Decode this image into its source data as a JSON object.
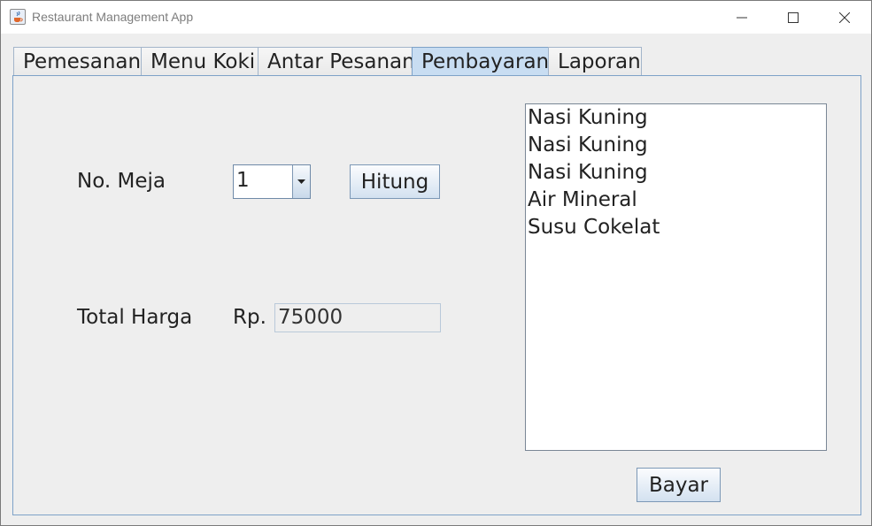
{
  "window": {
    "title": "Restaurant Management App"
  },
  "tabs": [
    {
      "label": "Pemesanan"
    },
    {
      "label": "Menu Koki"
    },
    {
      "label": "Antar Pesanan"
    },
    {
      "label": "Pembayaran",
      "active": true
    },
    {
      "label": "Laporan"
    }
  ],
  "payment": {
    "table_label": "No. Meja",
    "table_selected": "1",
    "calculate_button": "Hitung",
    "total_label": "Total Harga",
    "currency_prefix": "Rp.",
    "total_value": "75000",
    "pay_button": "Bayar",
    "order_items": [
      "Nasi Kuning",
      "Nasi Kuning",
      "Nasi Kuning",
      "Air Mineral",
      "Susu Cokelat"
    ]
  },
  "colors": {
    "active_tab": "#c8ddf2",
    "panel_border": "#7ea2c8",
    "background": "#eeeeee"
  }
}
